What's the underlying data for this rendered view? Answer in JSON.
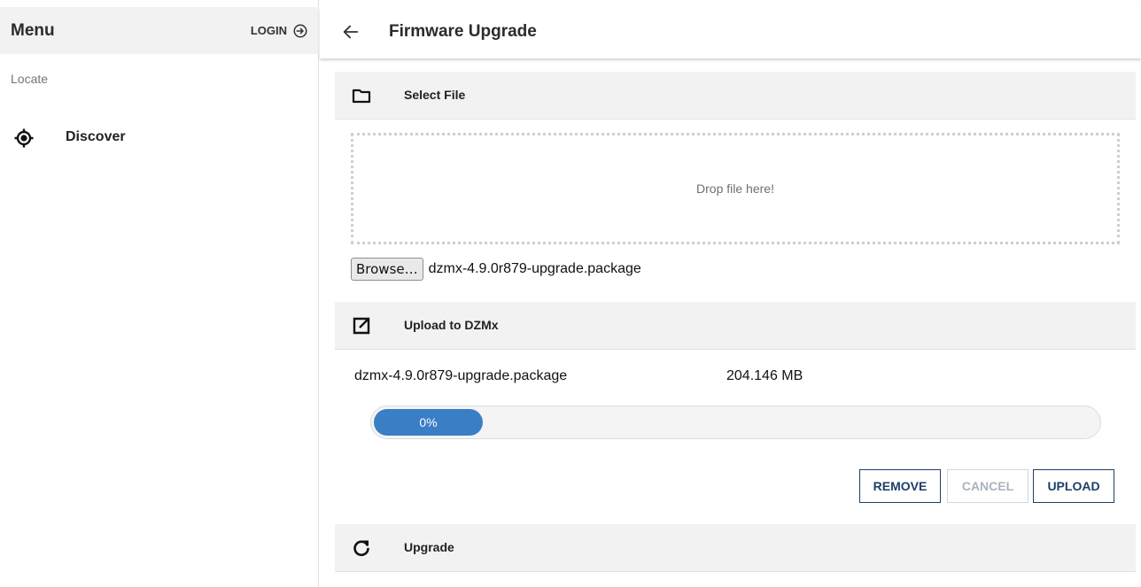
{
  "sidebar": {
    "title": "Menu",
    "login_label": "LOGIN",
    "section_label": "Locate",
    "items": [
      {
        "label": "Discover",
        "icon": "target-icon"
      }
    ]
  },
  "header": {
    "title": "Firmware Upgrade",
    "back_icon": "arrow-left-icon"
  },
  "sections": {
    "select_file": {
      "title": "Select File",
      "icon": "folder-icon"
    },
    "upload": {
      "title": "Upload to DZMx",
      "icon": "open-in-new-icon"
    },
    "upgrade": {
      "title": "Upgrade",
      "icon": "refresh-icon"
    }
  },
  "dropzone": {
    "text": "Drop file here!"
  },
  "file_input": {
    "browse_label": "Browse…",
    "selected_file": "dzmx-4.9.0r879-upgrade.package"
  },
  "upload_item": {
    "file_name": "dzmx-4.9.0r879-upgrade.package",
    "file_size": "204.146 MB",
    "progress_percent": 0,
    "progress_label": "0%"
  },
  "actions": {
    "remove_label": "REMOVE",
    "cancel_label": "CANCEL",
    "upload_label": "UPLOAD",
    "cancel_enabled": false
  },
  "colors": {
    "accent": "#1c3f66",
    "progress": "#3a7ec5",
    "section_bg": "#f2f2f2"
  }
}
